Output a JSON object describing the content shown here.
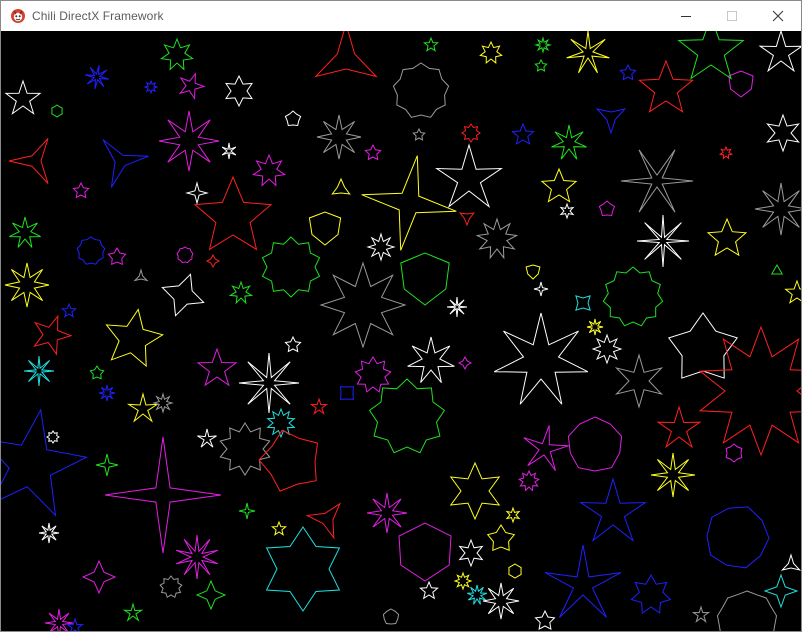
{
  "window": {
    "title": "Chili DirectX Framework",
    "icon": "chili-app-icon",
    "controls": [
      {
        "name": "minimize-button",
        "icon": "minimize-icon"
      },
      {
        "name": "maximize-button",
        "icon": "maximize-icon",
        "disabled": true
      },
      {
        "name": "close-button",
        "icon": "close-icon"
      }
    ]
  },
  "canvas": {
    "background": "#000000",
    "description_colors": {
      "white": "#ffffff",
      "gray": "#9a9a9a",
      "red": "#ff2020",
      "green": "#20e020",
      "blue": "#2020ff",
      "yellow": "#ffff20",
      "magenta": "#e020e0",
      "cyan": "#20e0e0"
    }
  }
}
